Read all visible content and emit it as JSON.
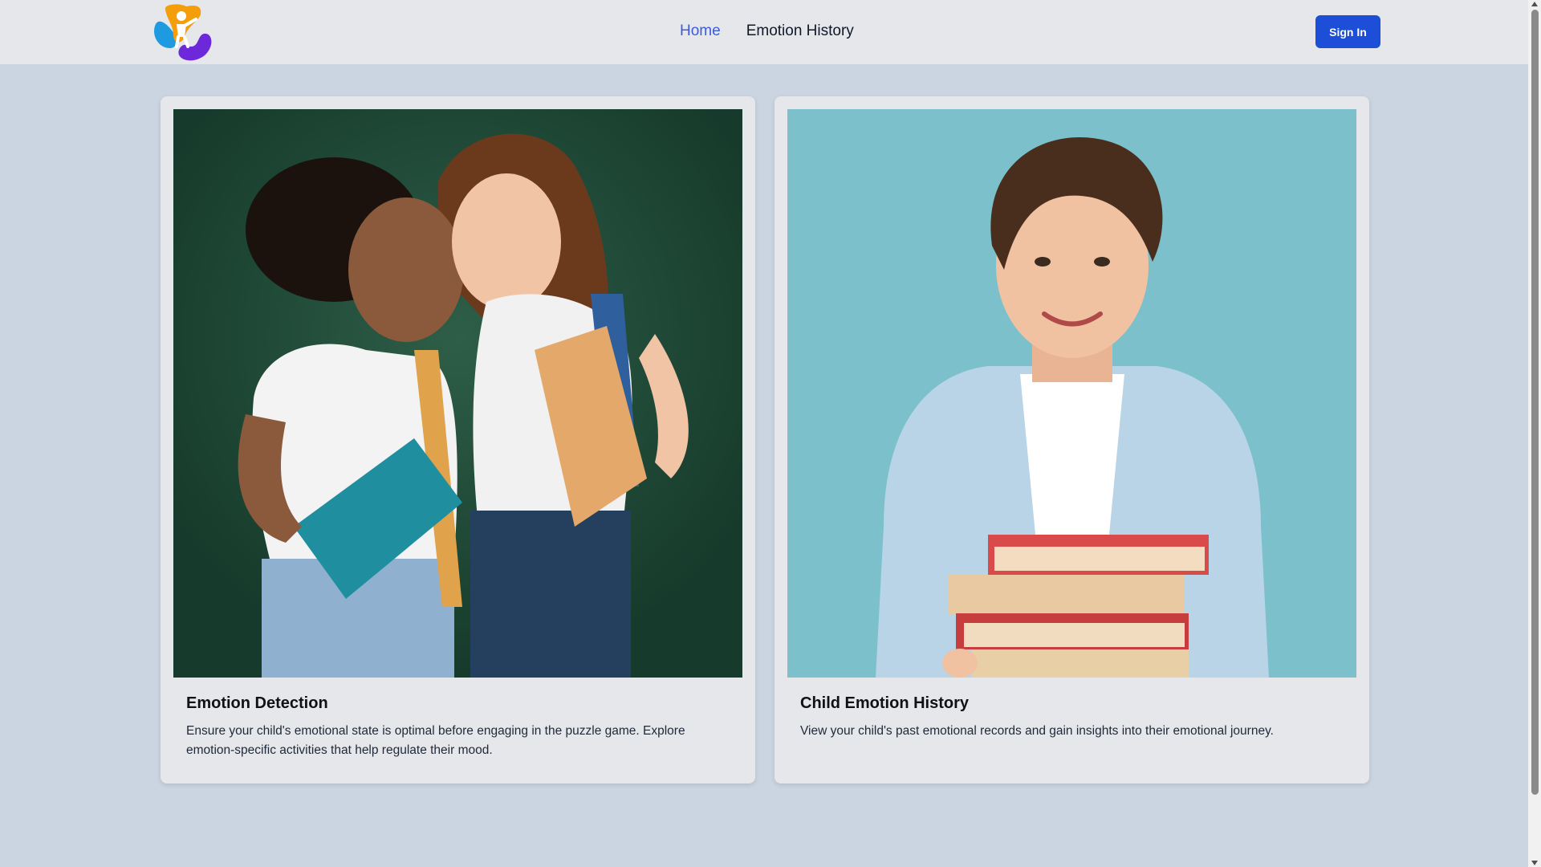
{
  "nav": {
    "logo_icon": "kids-logo-icon",
    "links": [
      {
        "label": "Home",
        "active": true
      },
      {
        "label": "Emotion History",
        "active": false
      }
    ],
    "signin_label": "Sign In"
  },
  "cards": [
    {
      "image": "two-girls-with-books-photo",
      "title": "Emotion Detection",
      "description": "Ensure your child's emotional state is optimal before engaging in the puzzle game. Explore emotion-specific activities that help regulate their mood."
    },
    {
      "image": "boy-with-stack-of-books-photo",
      "title": "Child Emotion History",
      "description": "View your child's past emotional records and gain insights into their emotional journey."
    }
  ],
  "colors": {
    "page_bg": "#cbd5e1",
    "header_bg": "#e5e7eb",
    "accent": "#1d4ed8",
    "active_link": "#3b5bdb"
  }
}
